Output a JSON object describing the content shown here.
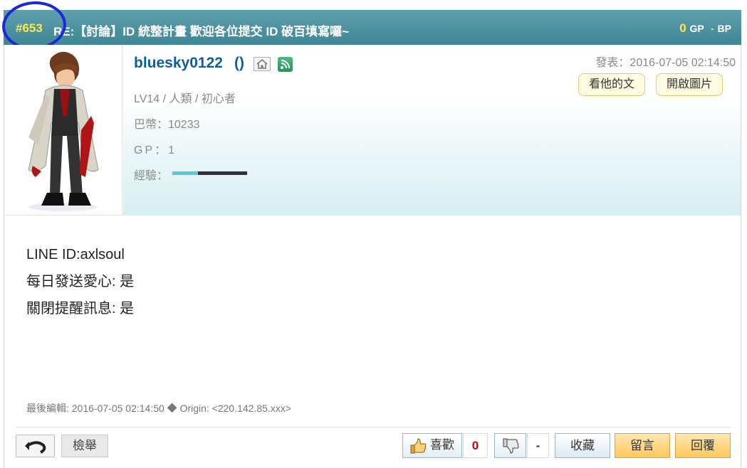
{
  "header": {
    "post_number": "#653",
    "title": "RE:【討論】ID 統整計畫 歡迎各位提交 ID 破百填寫囉~",
    "gp_value": "0",
    "gp_label": "GP",
    "bp_value": "-",
    "bp_label": "BP"
  },
  "user": {
    "name": "bluesky0122",
    "paren": "()",
    "level": "LV14 / 人類 / 初心者",
    "coins": "巴幣：10233",
    "gp": "GP：1",
    "exp_label": "經驗：",
    "exp_progress": 0.34
  },
  "post": {
    "date": "發表：2016-07-05 02:14:50",
    "view_his_posts": "看他的文",
    "open_images": "開啟圖片",
    "body_lines": [
      "LINE ID:axlsoul",
      "每日發送愛心: 是",
      "關閉提醒訊息: 是"
    ],
    "edit_info": "最後編輯: 2016-07-05 02:14:50 ◆ Origin: <220.142.85.xxx>"
  },
  "footer": {
    "report": "檢舉",
    "like": "喜歡",
    "like_count": "0",
    "dislike_count": "-",
    "favorite": "收藏",
    "comment": "留言",
    "reply": "回覆"
  },
  "colors": {
    "header_bg": "#4a8f9e",
    "accent_yellow": "#ffe94a",
    "username": "#0e5e9a",
    "annotation_circle": "#1b27d8"
  },
  "icons": [
    "home-icon",
    "rss-icon",
    "back-icon",
    "thumbs-up-icon",
    "thumbs-down-icon"
  ]
}
